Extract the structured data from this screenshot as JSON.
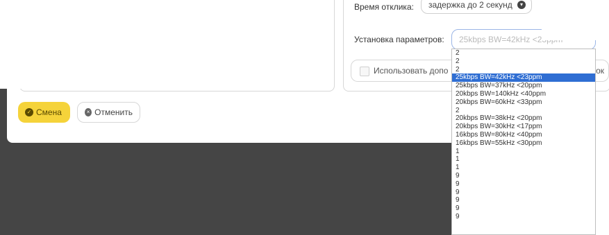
{
  "settings": {
    "response_time_label": "Время отклика:",
    "response_time_value": "задержка до 2 секунд",
    "param_label": "Установка параметров:",
    "param_value": "25kbps BW=42kHz <23ppm",
    "checkbox_label": "Использовать допо",
    "checkbox_label_tail": "бок"
  },
  "buttons": {
    "change": "Смена",
    "cancel": "Отменить"
  },
  "dropdown": {
    "items": [
      "2",
      "2",
      "2",
      "25kbps BW=42kHz <23ppm",
      "25kbps BW=37kHz <20ppm",
      "20kbps BW=140kHz <40ppm",
      "20kbps BW=60kHz <33ppm",
      "2",
      "20kbps BW=38kHz <20ppm",
      "20kbps BW=30kHz <17ppm",
      "16kbps BW=80kHz <40ppm",
      "16kbps BW=55kHz <30ppm",
      "1",
      "1",
      "1",
      "9",
      "9",
      "9",
      "9",
      "9",
      "9"
    ],
    "selected_index": 3
  },
  "colors": {
    "primary": "#f5d33a",
    "selection": "#2f6ed3",
    "backdrop": "#454545"
  }
}
